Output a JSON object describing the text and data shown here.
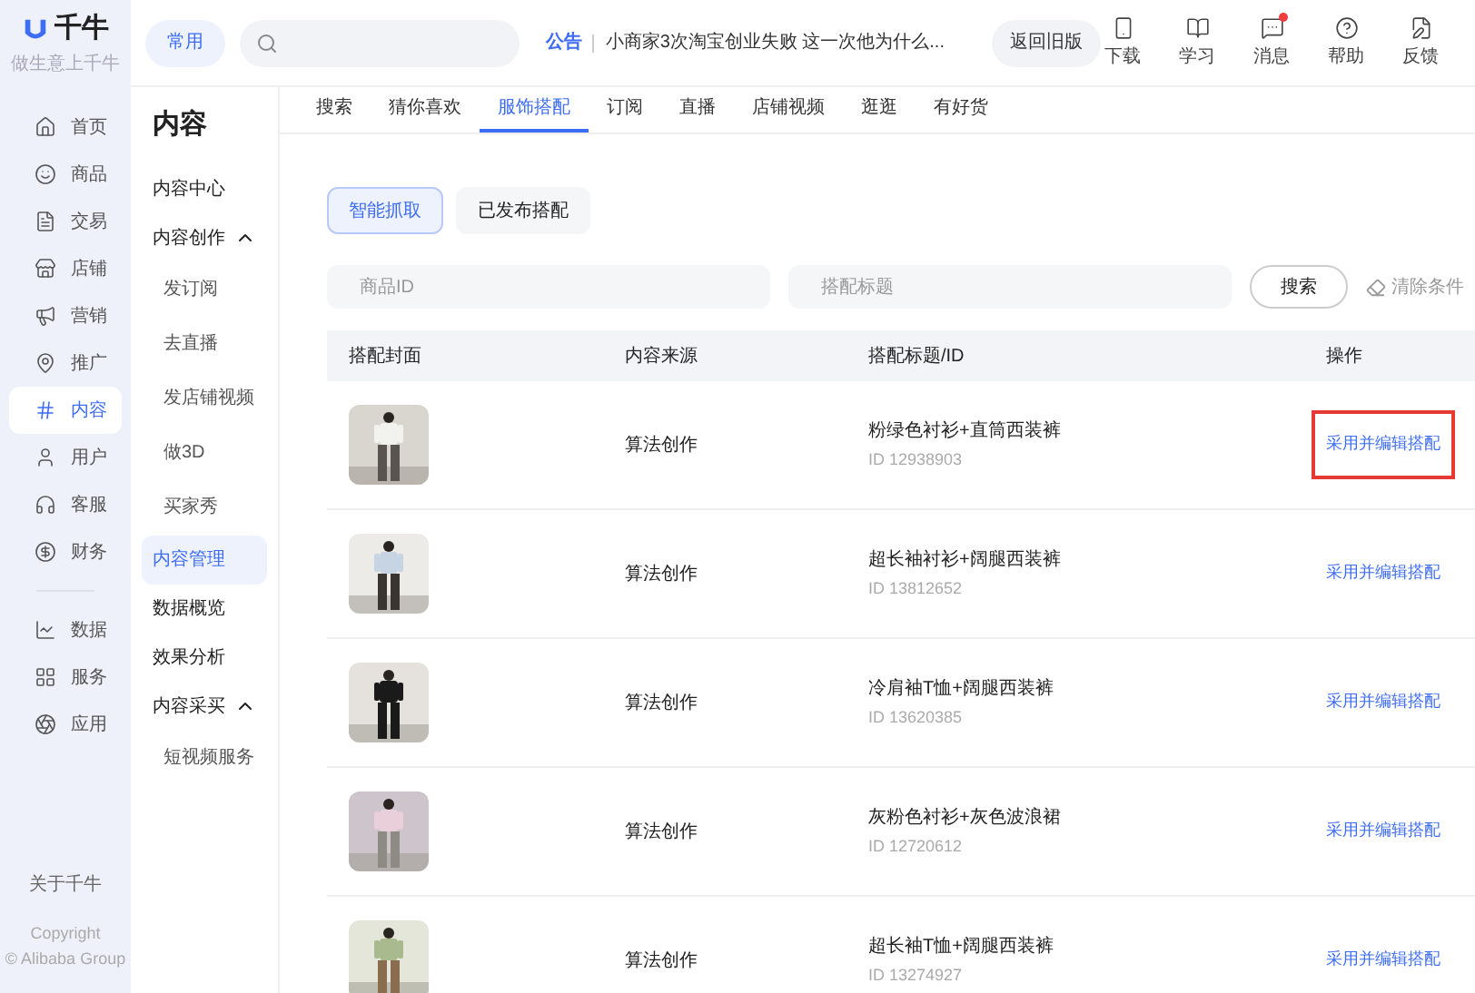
{
  "header": {
    "logo": {
      "name": "千牛",
      "slogan": "做生意上千牛"
    },
    "common_button": "常用",
    "notice": {
      "label": "公告",
      "text": "小商家3次淘宝创业失败 这一次他为什么..."
    },
    "back_button": "返回旧版",
    "tools": [
      {
        "kind": "download",
        "label": "下载",
        "badge": false
      },
      {
        "kind": "learn",
        "label": "学习",
        "badge": false
      },
      {
        "kind": "message",
        "label": "消息",
        "badge": true
      },
      {
        "kind": "help",
        "label": "帮助",
        "badge": false
      },
      {
        "kind": "feedback",
        "label": "反馈",
        "badge": false
      }
    ]
  },
  "rail": {
    "primary": [
      {
        "kind": "home",
        "label": "首页",
        "selected": false
      },
      {
        "kind": "goods",
        "label": "商品",
        "selected": false
      },
      {
        "kind": "trade",
        "label": "交易",
        "selected": false
      },
      {
        "kind": "shop",
        "label": "店铺",
        "selected": false
      },
      {
        "kind": "marketing",
        "label": "营销",
        "selected": false
      },
      {
        "kind": "promote",
        "label": "推广",
        "selected": false
      },
      {
        "kind": "content",
        "label": "内容",
        "selected": true
      },
      {
        "kind": "user",
        "label": "用户",
        "selected": false
      },
      {
        "kind": "service",
        "label": "客服",
        "selected": false
      },
      {
        "kind": "finance",
        "label": "财务",
        "selected": false
      }
    ],
    "secondary": [
      {
        "kind": "data",
        "label": "数据",
        "selected": false
      },
      {
        "kind": "services",
        "label": "服务",
        "selected": false
      },
      {
        "kind": "apps",
        "label": "应用",
        "selected": false
      }
    ],
    "about": "关于千牛",
    "copyright": [
      "Copyright",
      "© Alibaba Group"
    ]
  },
  "nav": {
    "title": "内容",
    "items": [
      {
        "label": "内容中心",
        "selected": false
      },
      {
        "label": "内容创作",
        "selected": false,
        "expanded": true,
        "children": [
          {
            "label": "发订阅",
            "selected": false
          },
          {
            "label": "去直播",
            "selected": false
          },
          {
            "label": "发店铺视频",
            "selected": false
          },
          {
            "label": "做3D",
            "selected": false
          },
          {
            "label": "买家秀",
            "selected": false
          }
        ]
      },
      {
        "label": "内容管理",
        "selected": true
      },
      {
        "label": "数据概览",
        "selected": false
      },
      {
        "label": "效果分析",
        "selected": false
      },
      {
        "label": "内容采买",
        "selected": false,
        "expanded": true,
        "children": [
          {
            "label": "短视频服务",
            "selected": false
          }
        ]
      }
    ]
  },
  "tabs": [
    {
      "label": "搜索",
      "selected": false
    },
    {
      "label": "猜你喜欢",
      "selected": false
    },
    {
      "label": "服饰搭配",
      "selected": true
    },
    {
      "label": "订阅",
      "selected": false
    },
    {
      "label": "直播",
      "selected": false
    },
    {
      "label": "店铺视频",
      "selected": false
    },
    {
      "label": "逛逛",
      "selected": false
    },
    {
      "label": "有好货",
      "selected": false
    }
  ],
  "subtabs": [
    {
      "label": "智能抓取",
      "selected": true
    },
    {
      "label": "已发布搭配",
      "selected": false
    }
  ],
  "filters": {
    "product_id": {
      "placeholder": "商品ID"
    },
    "title": {
      "placeholder": "搭配标题"
    },
    "search_button": "搜索",
    "clear_button": "清除条件"
  },
  "table": {
    "columns": [
      "搭配封面",
      "内容来源",
      "搭配标题/ID",
      "操作"
    ],
    "rows": [
      {
        "source": "算法创作",
        "title": "粉绿色衬衫+直筒西装裤",
        "id": "ID 12938903",
        "action": "采用并编辑搭配",
        "highlighted": true
      },
      {
        "source": "算法创作",
        "title": "超长袖衬衫+阔腿西装裤",
        "id": "ID 13812652",
        "action": "采用并编辑搭配",
        "highlighted": false
      },
      {
        "source": "算法创作",
        "title": "冷肩袖T恤+阔腿西装裤",
        "id": "ID 13620385",
        "action": "采用并编辑搭配",
        "highlighted": false
      },
      {
        "source": "算法创作",
        "title": "灰粉色衬衫+灰色波浪裙",
        "id": "ID 12720612",
        "action": "采用并编辑搭配",
        "highlighted": false
      },
      {
        "source": "算法创作",
        "title": "超长袖T恤+阔腿西装裤",
        "id": "ID 13274927",
        "action": "采用并编辑搭配",
        "highlighted": false
      }
    ]
  }
}
